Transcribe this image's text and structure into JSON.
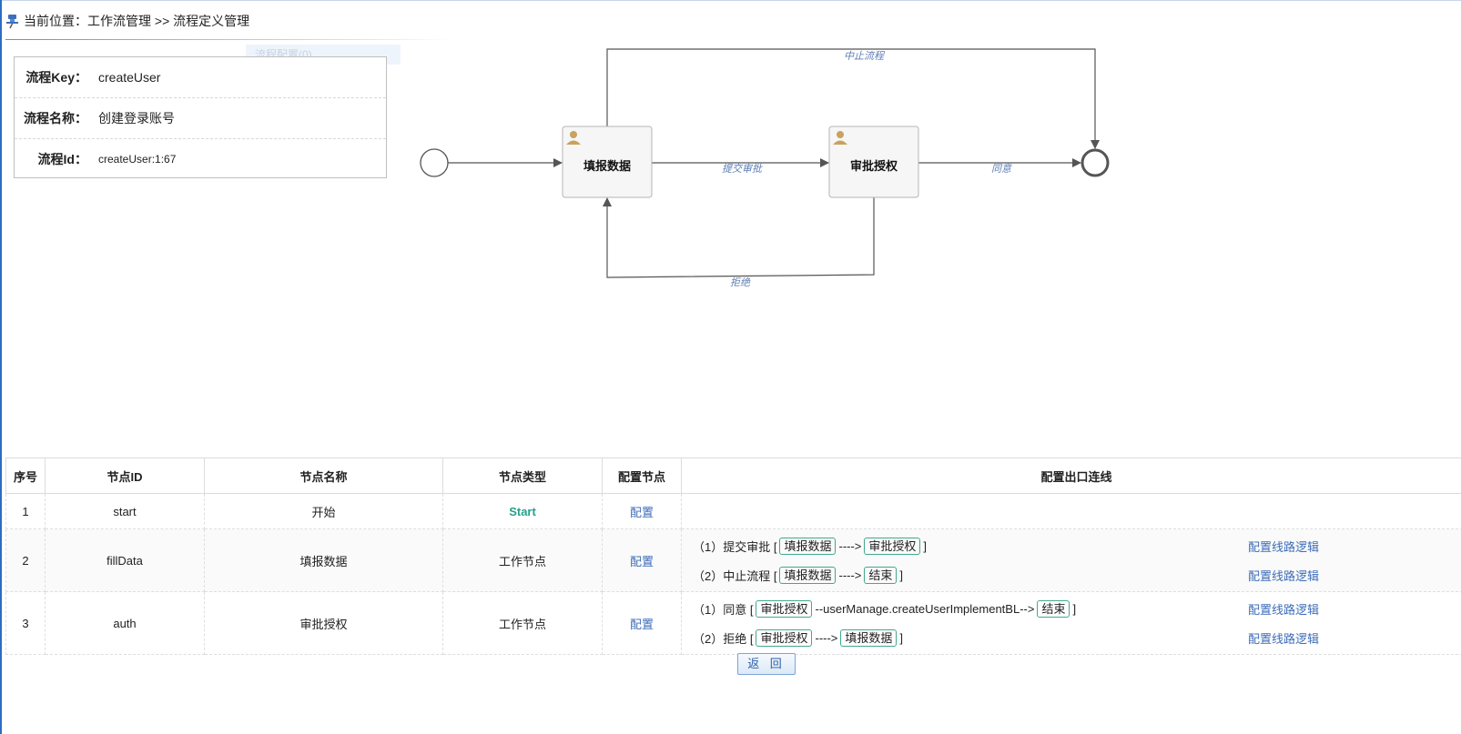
{
  "breadcrumb": {
    "text": "当前位置：工作流管理 >> 流程定义管理"
  },
  "ghost_tab": "流程配置(0)",
  "info": {
    "rows": [
      {
        "label": "流程Key：",
        "value": "createUser"
      },
      {
        "label": "流程名称：",
        "value": "创建登录账号"
      },
      {
        "label": "流程Id：",
        "value": "createUser:1:67"
      }
    ]
  },
  "diagram": {
    "tasks": [
      "填报数据",
      "审批授权"
    ],
    "flows": {
      "submit": "提交审批",
      "agree": "同意",
      "reject": "拒绝",
      "abort": "中止流程"
    }
  },
  "table": {
    "headers": [
      "序号",
      "节点ID",
      "节点名称",
      "节点类型",
      "配置节点",
      "配置出口连线"
    ],
    "rows": [
      {
        "no": "1",
        "id": "start",
        "name": "开始",
        "type": "Start",
        "config": "配置",
        "lines": []
      },
      {
        "no": "2",
        "id": "fillData",
        "name": "填报数据",
        "type": "工作节点",
        "config": "配置",
        "lines": [
          {
            "prefix": "（1）提交审批 [",
            "from": "填报数据",
            "mid": "---->",
            "to": "审批授权",
            "suffix": "]",
            "link": "配置线路逻辑"
          },
          {
            "prefix": "（2）中止流程 [",
            "from": "填报数据",
            "mid": "---->",
            "to": "结束",
            "suffix": "]",
            "link": "配置线路逻辑"
          }
        ]
      },
      {
        "no": "3",
        "id": "auth",
        "name": "审批授权",
        "type": "工作节点",
        "config": "配置",
        "lines": [
          {
            "prefix": "（1）同意 [",
            "from": "审批授权",
            "mid": "--userManage.createUserImplementBL-->",
            "to": "结束",
            "suffix": "]",
            "link": "配置线路逻辑"
          },
          {
            "prefix": "（2）拒绝 [",
            "from": "审批授权",
            "mid": "---->",
            "to": "填报数据",
            "suffix": "]",
            "link": "配置线路逻辑"
          }
        ]
      }
    ]
  },
  "back_button": "返 回",
  "colors": {
    "accent_blue": "#2b6cc4",
    "link_blue": "#3d6cb8",
    "tag_border": "#42a88e",
    "start_type": "#24a08a",
    "flow_label": "#5c7db5"
  }
}
